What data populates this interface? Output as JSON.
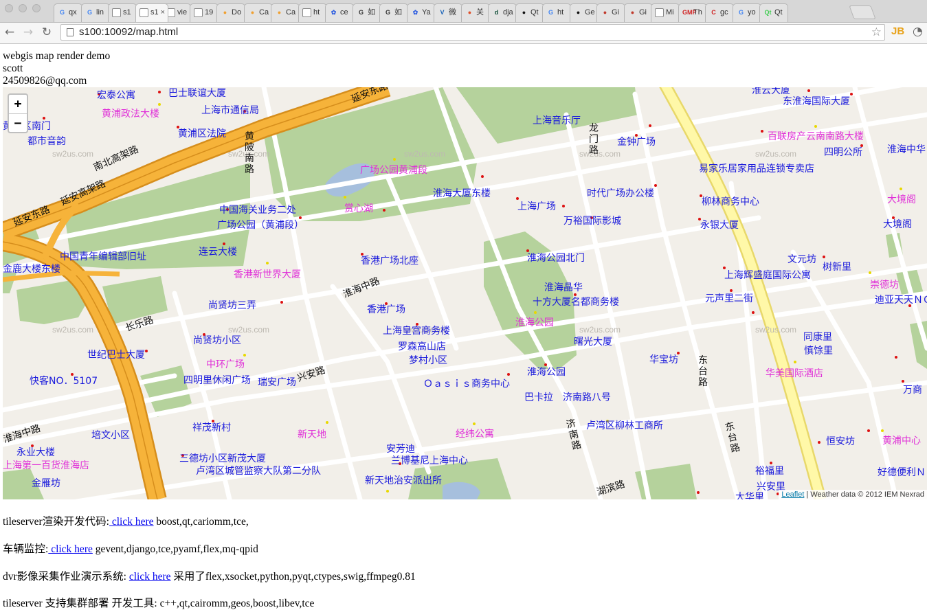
{
  "browser": {
    "tabs": [
      {
        "title": "qx",
        "fav": "G",
        "color": "#4285f4"
      },
      {
        "title": "lin",
        "fav": "G",
        "color": "#4285f4"
      },
      {
        "title": "s1",
        "fav": "",
        "color": "#888888"
      },
      {
        "title": "s1",
        "fav": "",
        "color": "#888888",
        "active": true
      },
      {
        "title": "vie",
        "fav": "",
        "color": "#888888"
      },
      {
        "title": "19",
        "fav": "",
        "color": "#888888"
      },
      {
        "title": "Do",
        "fav": "●",
        "color": "#f0a030"
      },
      {
        "title": "Ca",
        "fav": "●",
        "color": "#f0a030"
      },
      {
        "title": "Ca",
        "fav": "●",
        "color": "#f0a030"
      },
      {
        "title": "ht",
        "fav": "",
        "color": "#888888"
      },
      {
        "title": "ce",
        "fav": "✿",
        "color": "#2d5de0"
      },
      {
        "title": "如",
        "fav": "G",
        "color": "#333333"
      },
      {
        "title": "如",
        "fav": "G",
        "color": "#333333"
      },
      {
        "title": "Ya",
        "fav": "✿",
        "color": "#2d5de0"
      },
      {
        "title": "微",
        "fav": "V",
        "color": "#1a63b8"
      },
      {
        "title": "关",
        "fav": "●",
        "color": "#e0502a"
      },
      {
        "title": "dja",
        "fav": "d",
        "color": "#0c4b33"
      },
      {
        "title": "Qt",
        "fav": "●",
        "color": "#111111"
      },
      {
        "title": "ht",
        "fav": "G",
        "color": "#4285f4"
      },
      {
        "title": "Ge",
        "fav": "●",
        "color": "#111111"
      },
      {
        "title": "Gi",
        "fav": "●",
        "color": "#c0392b"
      },
      {
        "title": "Gi",
        "fav": "●",
        "color": "#c0392b"
      },
      {
        "title": "Mi",
        "fav": "",
        "color": "#888888"
      },
      {
        "title": "Th",
        "fav": "GMP",
        "color": "#d02020"
      },
      {
        "title": "gc",
        "fav": "C",
        "color": "#d02020"
      },
      {
        "title": "yo",
        "fav": "G",
        "color": "#4285f4"
      },
      {
        "title": "Qt",
        "fav": "Qt",
        "color": "#41cd52"
      }
    ],
    "url": "s100:10092/map.html",
    "icons": {
      "back": "back-arrow-icon",
      "forward": "forward-arrow-icon",
      "reload": "reload-icon",
      "star": "star-icon"
    }
  },
  "page": {
    "lines": [
      "webgis map render demo",
      "scott",
      "24509826@qq.com"
    ],
    "paragraphs": [
      {
        "prefix": "tileserver渲染开发代码:",
        "link": " click here",
        "suffix": " boost,qt,cariomm,tce,"
      },
      {
        "prefix": "车辆监控:",
        "link": " click here",
        "suffix": " gevent,django,tce,pyamf,flex,mq-qpid"
      },
      {
        "prefix": "dvr影像采集作业演示系统: ",
        "link": "click here",
        "suffix": " 采用了flex,xsocket,python,pyqt,ctypes,swig,ffmpeg0.81"
      },
      {
        "prefix": "tileserver 支持集群部署 开发工具: c++,qt,cairomm,geos,boost,libev,tce",
        "link": "",
        "suffix": ""
      }
    ]
  },
  "map": {
    "zoom_in": "+",
    "zoom_out": "−",
    "attribution": {
      "link": "Leaflet",
      "text": " | Weather data © 2012 IEM Nexrad"
    },
    "watermark": "sw2us.com",
    "labels": {
      "blue": [
        "宏泰公寓",
        "巴士联谊大厦",
        "上海市通信局",
        "黄浦区法院",
        "都市音韵",
        "中国海关业务二处",
        "广场公园（黄浦段）",
        "中国青年编辑部旧址",
        "金鹿大楼东楼",
        "连云大楼",
        "尚贤坊三弄",
        "尚贤坊小区",
        "世纪巴士大厦",
        "快客NO．5107",
        "四明里休闲广场",
        "瑞安广场",
        "培文小区",
        "永业大楼",
        "祥茂新村",
        "三德坊小区新茂大厦",
        "卢湾区城管监察大队第二分队",
        "金雁坊",
        "新天地治安派出所",
        "安芳迪",
        "兰博基尼上海中心",
        "香港广场北座",
        "香港广场",
        "上海皇宫商务楼",
        "罗森高山店",
        "梦村小区",
        "Ｏａｓｉｓ商务中心",
        "巴卡拉",
        "济南路八号",
        "淮海大厦东楼",
        "上海广场",
        "万裕国际影城",
        "时代广场办公楼",
        "上海音乐厅",
        "金钟广场",
        "淮海公园北门",
        "淮海晶华",
        "十方大厦名都商务楼",
        "曙光大厦",
        "淮海公园",
        "华宝坊",
        "卢湾区柳林工商所",
        "易家乐居家用品连锁专卖店",
        "柳林商务中心",
        "永银大厦",
        "淮云大厦",
        "东淮海国际大厦",
        "四明公所",
        "淮海中华",
        "大境阁",
        "上海辉盛庭国际公寓",
        "文元坊",
        "树新里",
        "元声里二街",
        "迪亚天天ＮＯ",
        "同康里",
        "慎馀里",
        "恒安坊",
        "裕福里",
        "兴安里",
        "万商",
        "好德便利Ｎ",
        "大华里",
        "延安东路",
        "黄浦区南门"
      ],
      "magenta": [
        "黄浦政法大楼",
        "广场公园黄浦段",
        "赏心湖",
        "香港新世界大厦",
        "中环广场",
        "新天地",
        "经纬公寓",
        "淮海公园",
        "百联房产云南南路大楼",
        "大境阁",
        "崇德坊",
        "华美国际酒店",
        "黄浦中心",
        "上海第一百货淮海店"
      ],
      "roads": [
        "南北高架路",
        "延安高架路",
        "延安东路",
        "黄陂南路",
        "龙门路",
        "淮海中路",
        "长乐路",
        "兴安路",
        "东台路",
        "济南路",
        "湖滨路",
        "淮海中路"
      ]
    }
  }
}
